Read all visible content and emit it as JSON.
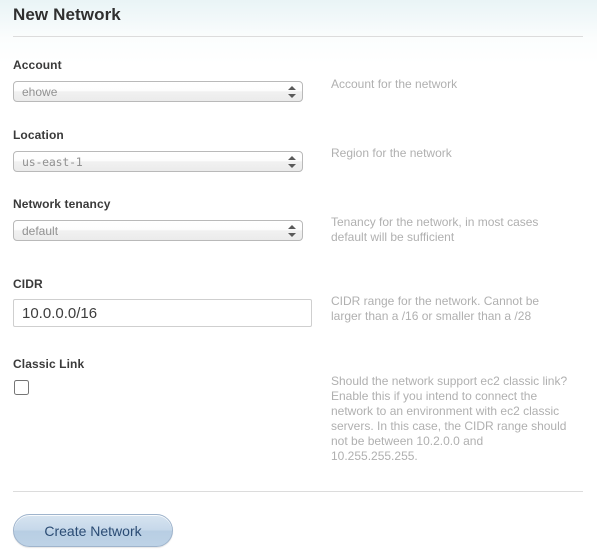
{
  "header": {
    "title": "New Network"
  },
  "form": {
    "account": {
      "label": "Account",
      "value": "ehowe",
      "help": "Account for the network",
      "icon": "chevron-updown-icon"
    },
    "location": {
      "label": "Location",
      "value": "us-east-1",
      "help": "Region for the network",
      "icon": "chevron-updown-icon"
    },
    "tenancy": {
      "label": "Network tenancy",
      "value": "default",
      "help": "Tenancy for the network, in most cases default will be sufficient",
      "icon": "chevron-updown-icon"
    },
    "cidr": {
      "label": "CIDR",
      "value": "10.0.0.0/16",
      "placeholder": "",
      "help": "CIDR range for the network. Cannot be larger than a /16 or smaller than a /28"
    },
    "classic_link": {
      "label": "Classic Link",
      "checked": false,
      "help": "Should the network support ec2 classic link? Enable this if you intend to connect the network to an environment with ec2 classic servers. In this case, the CIDR range should not be between 10.2.0.0 and 10.255.255.255."
    }
  },
  "actions": {
    "submit_label": "Create Network"
  },
  "colors": {
    "header_tint": "#e9f4f6",
    "label_text": "#3a3a3a",
    "help_text": "#b0b0b0",
    "button_text": "#2b4c74",
    "button_fill": "#c6d8ea",
    "rule": "#dcdcdc"
  }
}
